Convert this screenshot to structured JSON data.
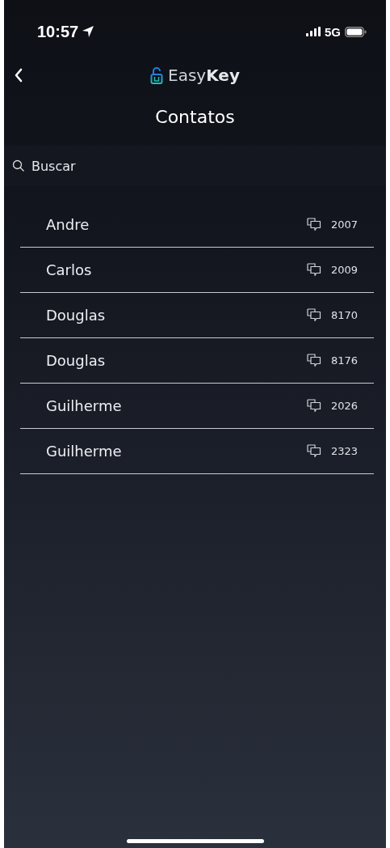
{
  "status_bar": {
    "time": "10:57",
    "network": "5G"
  },
  "nav": {
    "brand_light": "Easy",
    "brand_bold": "Key"
  },
  "title": "Contatos",
  "search": {
    "placeholder": "Buscar"
  },
  "contacts": [
    {
      "name": "Andre",
      "extension": "2007"
    },
    {
      "name": "Carlos",
      "extension": "2009"
    },
    {
      "name": "Douglas",
      "extension": "8170"
    },
    {
      "name": "Douglas",
      "extension": "8176"
    },
    {
      "name": "Guilherme",
      "extension": "2026"
    },
    {
      "name": "Guilherme",
      "extension": "2323"
    }
  ]
}
